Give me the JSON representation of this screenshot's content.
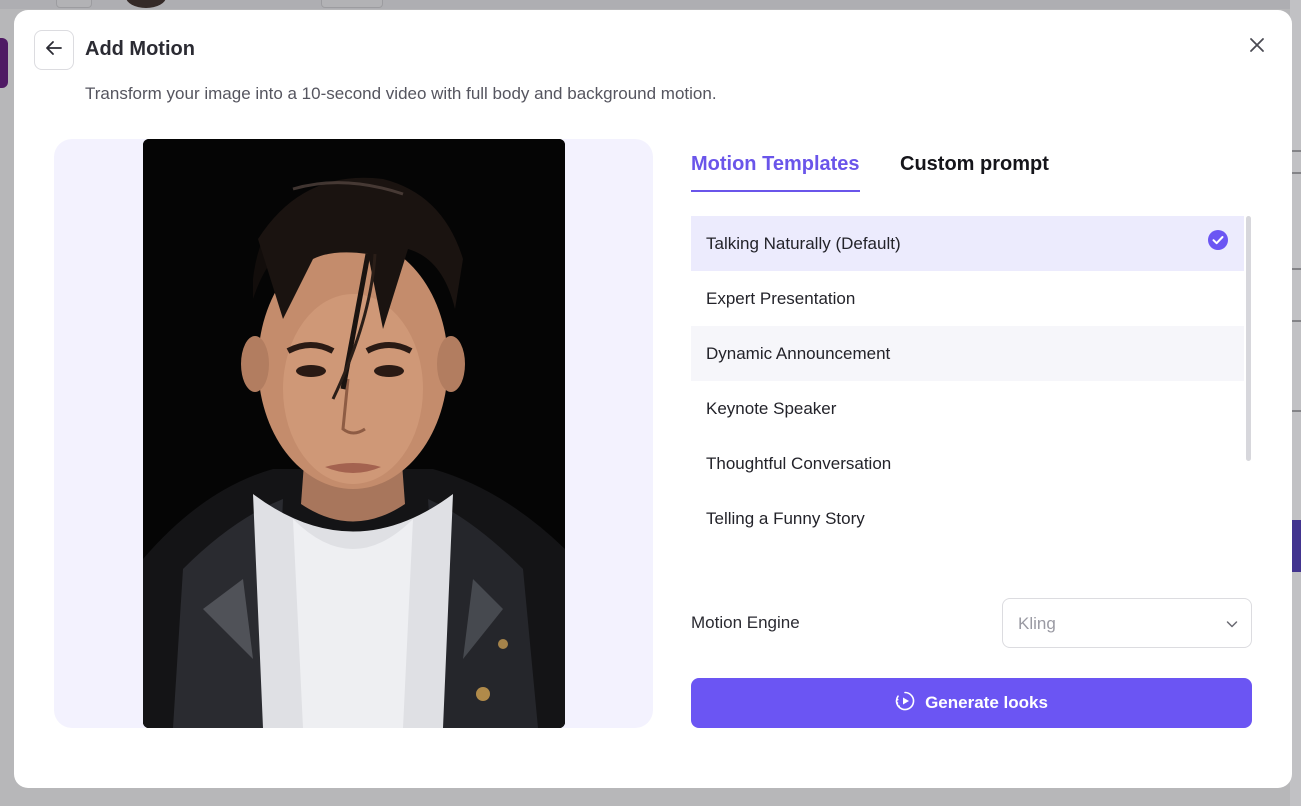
{
  "dialog": {
    "title": "Add Motion",
    "subtitle": "Transform your image into a 10-second video with full body and background motion."
  },
  "tabs": [
    {
      "label": "Motion Templates",
      "active": true
    },
    {
      "label": "Custom prompt",
      "active": false
    }
  ],
  "templates": [
    {
      "label": "Talking Naturally (Default)",
      "selected": true
    },
    {
      "label": "Expert Presentation",
      "selected": false
    },
    {
      "label": "Dynamic Announcement",
      "selected": false
    },
    {
      "label": "Keynote Speaker",
      "selected": false
    },
    {
      "label": "Thoughtful Conversation",
      "selected": false
    },
    {
      "label": "Telling a Funny Story",
      "selected": false
    }
  ],
  "engine": {
    "label": "Motion Engine",
    "value": "Kling"
  },
  "generate": {
    "label": "Generate looks"
  },
  "icons": {
    "back": "arrow-left-icon",
    "close": "close-icon",
    "check": "check-circle-icon",
    "chevron": "chevron-down-icon",
    "generate": "motion-play-icon"
  },
  "colors": {
    "accent": "#6b55f3",
    "selected_bg": "#ecebfd",
    "preview_bg": "#f3f2fe"
  }
}
